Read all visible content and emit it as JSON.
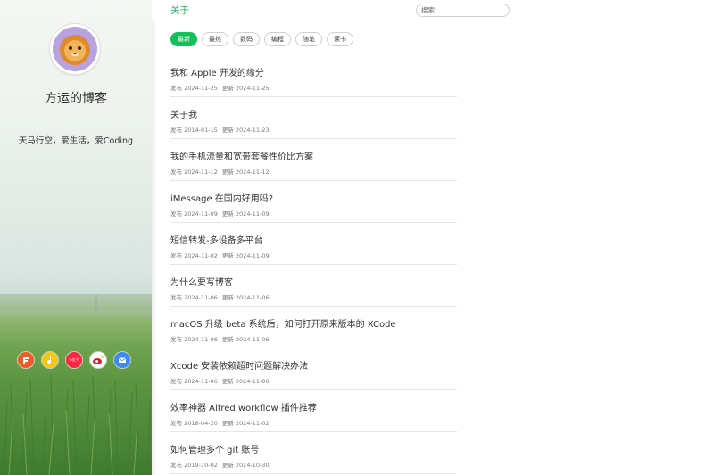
{
  "sidebar": {
    "blog_title": "方运的博客",
    "motto": "天马行空，爱生活，爱Coding",
    "social_icons": [
      {
        "name": "flomo-icon",
        "color": "#f05a28"
      },
      {
        "name": "music-icon",
        "color": "#f5c518"
      },
      {
        "name": "xiaohongshu-icon",
        "color": "#ff2442",
        "text": "小红书"
      },
      {
        "name": "weibo-icon",
        "color": "#e6162d"
      },
      {
        "name": "mail-icon",
        "color": "#3d8af7"
      }
    ]
  },
  "topbar": {
    "nav_label": "关于",
    "search_placeholder": "搜索"
  },
  "tags": [
    "最新",
    "最热",
    "数码",
    "编程",
    "随笔",
    "读书"
  ],
  "posts": [
    {
      "title": "我和 Apple 开发的缘分",
      "published": "发布 2024-11-25",
      "updated": "更新 2024-11-25"
    },
    {
      "title": "关于我",
      "published": "发布 2014-01-15",
      "updated": "更新 2024-11-23"
    },
    {
      "title": "我的手机流量和宽带套餐性价比方案",
      "published": "发布 2024-11-12",
      "updated": "更新 2024-11-12"
    },
    {
      "title": "iMessage 在国内好用吗?",
      "published": "发布 2024-11-09",
      "updated": "更新 2024-11-09"
    },
    {
      "title": "短信转发-多设备多平台",
      "published": "发布 2024-11-02",
      "updated": "更新 2024-11-09"
    },
    {
      "title": "为什么要写博客",
      "published": "发布 2024-11-06",
      "updated": "更新 2024-11-06"
    },
    {
      "title": "macOS 升级 beta 系统后，如何打开原来版本的 XCode",
      "published": "发布 2024-11-06",
      "updated": "更新 2024-11-06"
    },
    {
      "title": "Xcode 安装依赖超时问题解决办法",
      "published": "发布 2024-11-06",
      "updated": "更新 2024-11-06"
    },
    {
      "title": "效率神器 Alfred workflow 插件推荐",
      "published": "发布 2018-04-20",
      "updated": "更新 2024-11-02"
    },
    {
      "title": "如何管理多个 git 账号",
      "published": "发布 2019-10-02",
      "updated": "更新 2024-10-30"
    }
  ],
  "colors": {
    "accent": "#13c05b",
    "nav_accent": "#27ae60"
  }
}
